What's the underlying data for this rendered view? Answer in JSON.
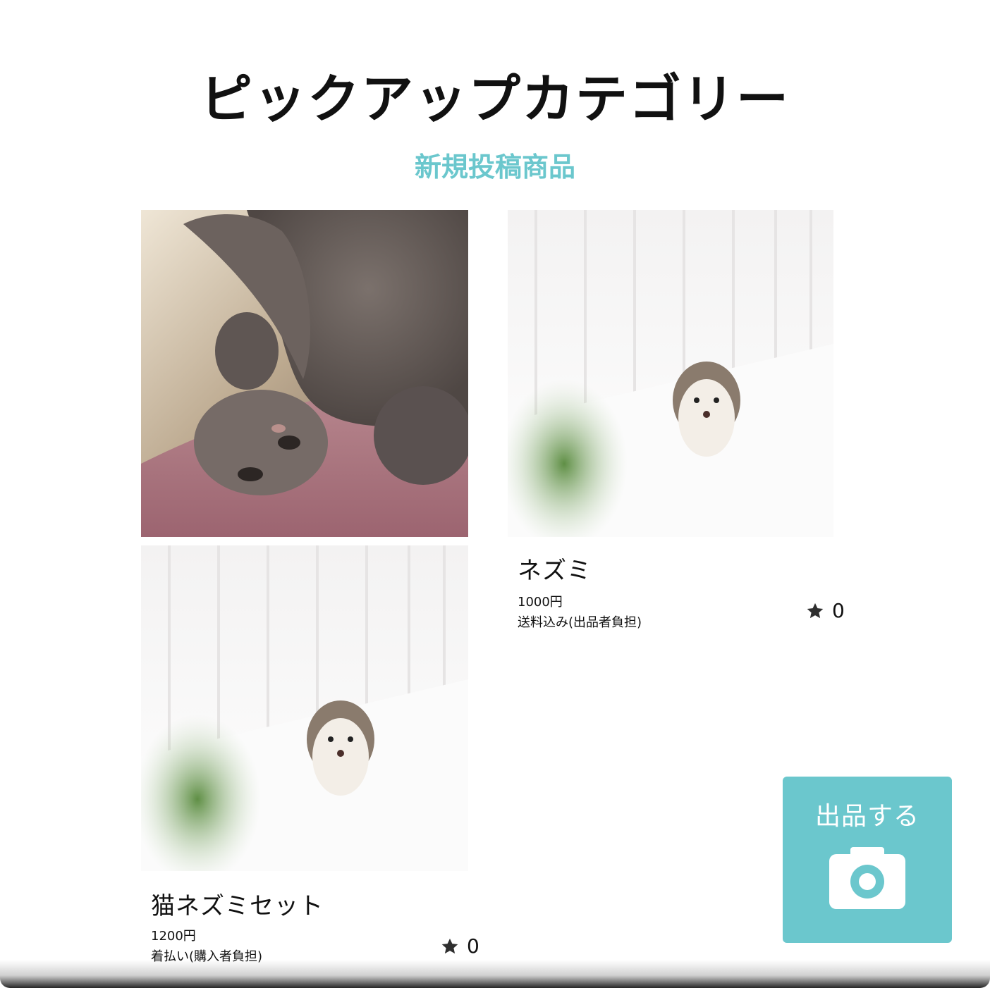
{
  "header": {
    "title": "ピックアップカテゴリー",
    "subtitle": "新規投稿商品"
  },
  "products": [
    {
      "image": "cat-photo",
      "name": "",
      "price": "",
      "shipping": "",
      "likes": ""
    },
    {
      "image": "hedgehog-photo",
      "name": "ネズミ",
      "price": "1000円",
      "shipping": "送料込み(出品者負担)",
      "likes": "0"
    },
    {
      "image": "hedgehog-photo",
      "name": "猫ネズミセット",
      "price": "1200円",
      "shipping": "着払い(購入者負担)",
      "likes": "0"
    }
  ],
  "sell_button": {
    "label": "出品する",
    "icon": "camera-icon"
  },
  "colors": {
    "accent": "#6bc7cd",
    "text": "#111111",
    "background": "#ffffff"
  }
}
